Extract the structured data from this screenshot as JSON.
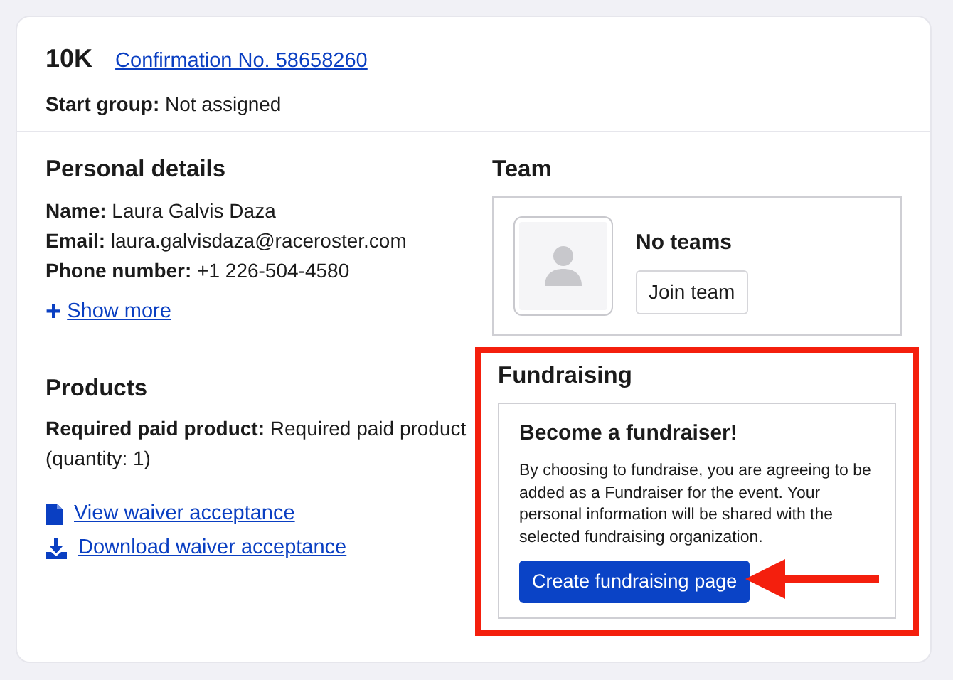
{
  "registration": {
    "title": "10K",
    "confirmation_link": "Confirmation No. 58658260",
    "details": [
      {
        "label": "Start group:",
        "value": "Not assigned"
      }
    ]
  },
  "personal_details": {
    "heading": "Personal details",
    "fields": [
      {
        "label": "Name:",
        "value": "Laura Galvis Daza"
      },
      {
        "label": "Email:",
        "value": "laura.galvisdaza@raceroster.com"
      },
      {
        "label": "Phone number:",
        "value": "+1 226-504-4580"
      }
    ],
    "show_more": {
      "icon": "+",
      "label": "Show more"
    }
  },
  "products": {
    "heading": "Products",
    "items": [
      {
        "label": "Required paid product:",
        "value": "Required paid product (quantity: 1)"
      }
    ],
    "links": [
      {
        "kind": "view",
        "label": "View waiver acceptance"
      },
      {
        "kind": "download",
        "label": "Download waiver acceptance"
      }
    ]
  },
  "team": {
    "heading": "Team",
    "status": "No teams",
    "button": "Join team"
  },
  "fundraising": {
    "heading": "Fundraising",
    "highlighted": true,
    "arrow": true,
    "card_title": "Become a fundraiser!",
    "description": "By choosing to fundraise, you are agreeing to be added as a Fundraiser for the event. Your personal information will be shared with the selected fundraising organization.",
    "button": "Create fundraising page"
  }
}
